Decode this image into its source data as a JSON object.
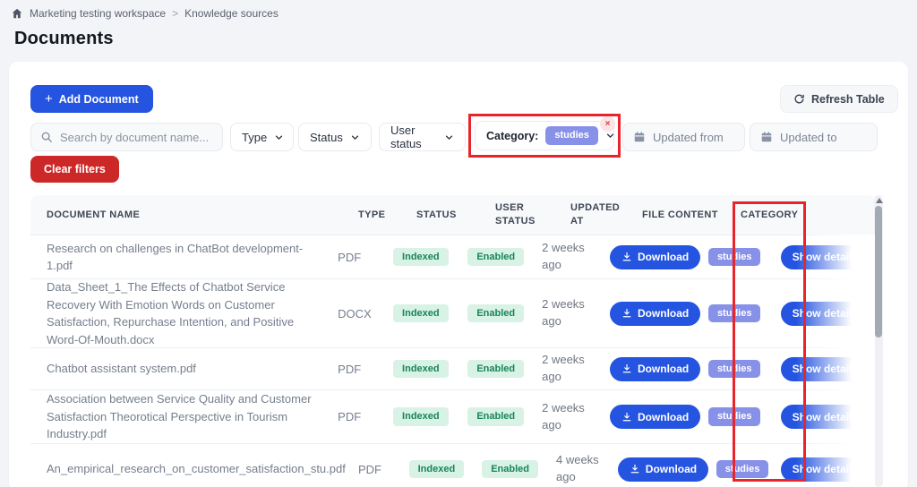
{
  "breadcrumb": {
    "items": [
      "Marketing testing workspace",
      "Knowledge sources"
    ],
    "separator": ">"
  },
  "page": {
    "title": "Documents"
  },
  "toolbar": {
    "add_document": "Add Document",
    "refresh_table": "Refresh Table"
  },
  "filters": {
    "search_placeholder": "Search by document name...",
    "type_label": "Type",
    "status_label": "Status",
    "user_status_label": "User status",
    "category_label": "Category:",
    "category_value": "studies",
    "remove_category": "x",
    "updated_from_label": "Updated from",
    "updated_to_label": "Updated to",
    "clear_label": "Clear filters"
  },
  "table": {
    "headers": [
      "DOCUMENT NAME",
      "TYPE",
      "STATUS",
      "USER STATUS",
      "UPDATED AT",
      "FILE CONTENT",
      "CATEGORY"
    ],
    "actions": {
      "download": "Download",
      "show_details": "Show details"
    },
    "rows": [
      {
        "name": "Research on challenges in ChatBot development-1.pdf",
        "type": "PDF",
        "status": "Indexed",
        "user_status": "Enabled",
        "updated": "2 weeks ago",
        "category": "studies"
      },
      {
        "name": "Data_Sheet_1_The Effects of Chatbot Service Recovery With Emotion Words on Customer Satisfaction, Repurchase Intention, and Positive Word-Of-Mouth.docx",
        "type": "DOCX",
        "status": "Indexed",
        "user_status": "Enabled",
        "updated": "2 weeks ago",
        "category": "studies"
      },
      {
        "name": "Chatbot assistant system.pdf",
        "type": "PDF",
        "status": "Indexed",
        "user_status": "Enabled",
        "updated": "2 weeks ago",
        "category": "studies"
      },
      {
        "name": "Association between Service Quality and Customer Satisfaction Theorotical Perspective in Tourism Industry.pdf",
        "type": "PDF",
        "status": "Indexed",
        "user_status": "Enabled",
        "updated": "2 weeks ago",
        "category": "studies"
      },
      {
        "name": "An_empirical_research_on_customer_satisfaction_stu.pdf",
        "type": "PDF",
        "status": "Indexed",
        "user_status": "Enabled",
        "updated": "4 weeks ago",
        "category": "studies"
      }
    ]
  },
  "colors": {
    "accent_blue": "#2454e0",
    "danger_red": "#cd2828",
    "annotation_red": "#e8252b",
    "badge_green_bg": "#d9f2e6",
    "badge_green_text": "#17855a",
    "chip_indigo": "#8891e8"
  }
}
